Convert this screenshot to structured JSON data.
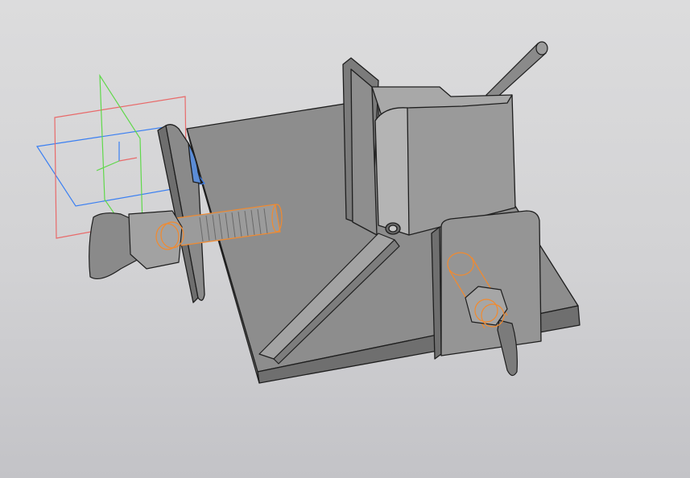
{
  "viewport": {
    "background_top": "#dcdcdd",
    "background_bottom": "#c3c3c7"
  },
  "model": {
    "body_color": "#8f8f8f",
    "edge_color": "#1e1e1e",
    "highlight_color": "#f28a2e"
  },
  "origin_planes": {
    "xy_color": "#3a7ff2",
    "zx_color": "#e86a6a",
    "yz_color": "#5fd84a"
  },
  "icons": [
    "origin-triad-icon",
    "fixture-model-icon"
  ]
}
